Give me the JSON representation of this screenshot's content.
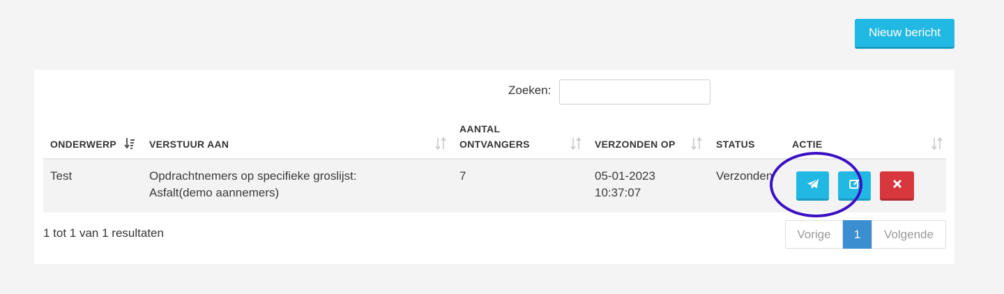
{
  "toolbar": {
    "new_message_label": "Nieuw bericht"
  },
  "search": {
    "label": "Zoeken:",
    "value": "",
    "placeholder": ""
  },
  "table": {
    "columns": [
      "ONDERWERP",
      "VERSTUUR AAN",
      "AANTAL",
      "ONTVANGERS",
      "VERZONDEN OP",
      "STATUS",
      "ACTIE"
    ],
    "rows": [
      {
        "subject": "Test",
        "send_to_line1": "Opdrachtnemers op specifieke groslijst:",
        "send_to_line2": "Asfalt(demo aannemers)",
        "recipients": "7",
        "sent_date": "05-01-2023",
        "sent_time": "10:37:07",
        "status": "Verzonden"
      }
    ]
  },
  "footer": {
    "results_text": "1 tot 1 van 1 resultaten"
  },
  "pagination": {
    "prev": "Vorige",
    "current": "1",
    "next": "Volgende"
  },
  "colors": {
    "primary": "#21b8e3",
    "danger": "#d7373d",
    "page_active": "#3b8ed0",
    "highlight": "#3a10c4"
  },
  "icons": [
    "sort-desc-icon",
    "sort-icon",
    "send-icon",
    "edit-icon",
    "close-icon"
  ]
}
